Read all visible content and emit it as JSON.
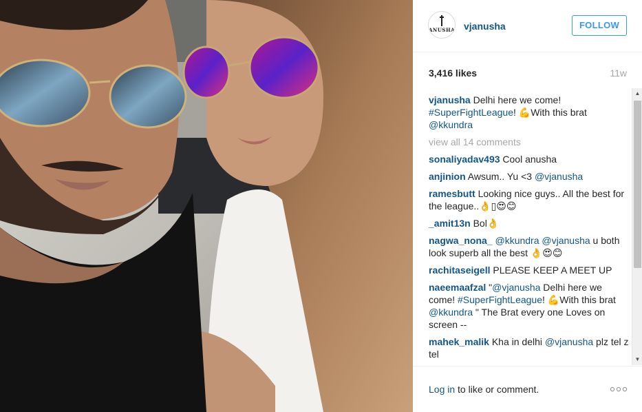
{
  "post": {
    "username": "vjanusha",
    "follow_label": "FOLLOW",
    "avatar_text": "ANUSHA",
    "likes": "3,416 likes",
    "age": "11w",
    "caption": {
      "user": "vjanusha",
      "text_1": " Delhi here we come! ",
      "hashtag": "#SuperFightLeague",
      "text_2": "! 💪With this brat ",
      "mention": "@kkundra"
    },
    "view_all": "view all 14 comments",
    "comments": [
      {
        "user": "sonaliyadav493",
        "text": " Cool anusha"
      },
      {
        "user": "anjinion",
        "text": " Awsum.. Yu <3 ",
        "mention": "@vjanusha"
      },
      {
        "user": "ramesbutt",
        "text": " Looking nice guys.. All the best for the league..👌▯😍😊"
      },
      {
        "user": "_amit13n",
        "text": " Bol👌"
      },
      {
        "user": "nagwa_nona_",
        "mention_a": "@kkundra",
        "mention_b": "@vjanusha",
        "text": " u both look superb all the best 👌😍😊"
      },
      {
        "user": "rachitaseigell",
        "text": " PLEASE KEEP A MEET UP"
      },
      {
        "user": "naeemaafzal",
        "text_1": " \"",
        "mention_a": "@vjanusha",
        "text_2": " Delhi here we come! ",
        "hashtag": "#SuperFightLeague",
        "text_3": "! 💪With this brat ",
        "mention_b": "@kkundra",
        "text_4": " \" The Brat every one Loves on screen --"
      },
      {
        "user": "mahek_malik",
        "text": " Kha in delhi ",
        "mention": "@vjanusha",
        "text_2": " plz tel z tel"
      }
    ],
    "footer": {
      "login": "Log in",
      "rest": " to like or comment."
    }
  },
  "icons": {
    "more": "more-options-icon",
    "scroll_up": "chevron-up-icon",
    "scroll_down": "chevron-down-icon"
  },
  "colors": {
    "link": "#125688",
    "accent": "#3897f0",
    "muted": "#a5a7aa"
  }
}
